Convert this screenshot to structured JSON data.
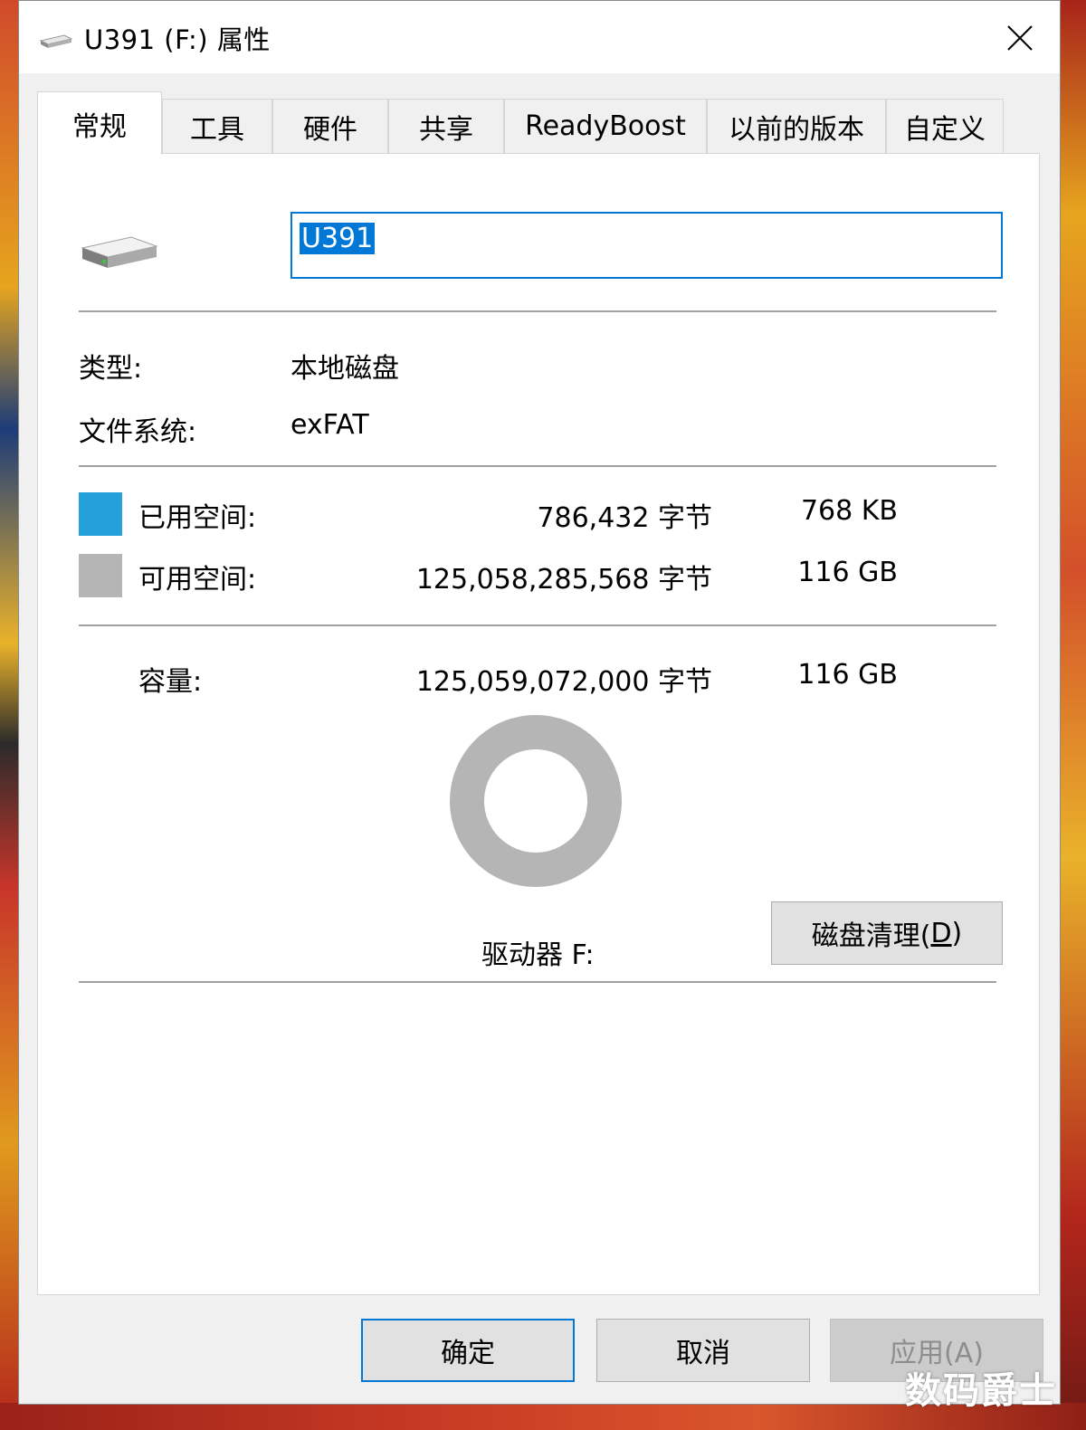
{
  "window": {
    "title": "U391 (F:) 属性"
  },
  "tabs": [
    {
      "label": "常规",
      "active": true
    },
    {
      "label": "工具",
      "active": false
    },
    {
      "label": "硬件",
      "active": false
    },
    {
      "label": "共享",
      "active": false
    },
    {
      "label": "ReadyBoost",
      "active": false
    },
    {
      "label": "以前的版本",
      "active": false
    },
    {
      "label": "自定义",
      "active": false
    }
  ],
  "general": {
    "volume_name": "U391",
    "type_label": "类型:",
    "type_value": "本地磁盘",
    "fs_label": "文件系统:",
    "fs_value": "exFAT",
    "used": {
      "label": "已用空间:",
      "bytes": "786,432 字节",
      "size": "768 KB",
      "color": "#26a0da"
    },
    "free": {
      "label": "可用空间:",
      "bytes": "125,058,285,568 字节",
      "size": "116 GB",
      "color": "#b5b5b5"
    },
    "capacity": {
      "label": "容量:",
      "bytes": "125,059,072,000 字节",
      "size": "116 GB"
    },
    "drive_label": "驱动器 F:",
    "cleanup_button": {
      "text": "磁盘清理(",
      "mnemonic": "D",
      "suffix": ")"
    }
  },
  "buttons": {
    "ok": "确定",
    "cancel": "取消",
    "apply": "应用(A)"
  },
  "watermark": "数码爵士"
}
